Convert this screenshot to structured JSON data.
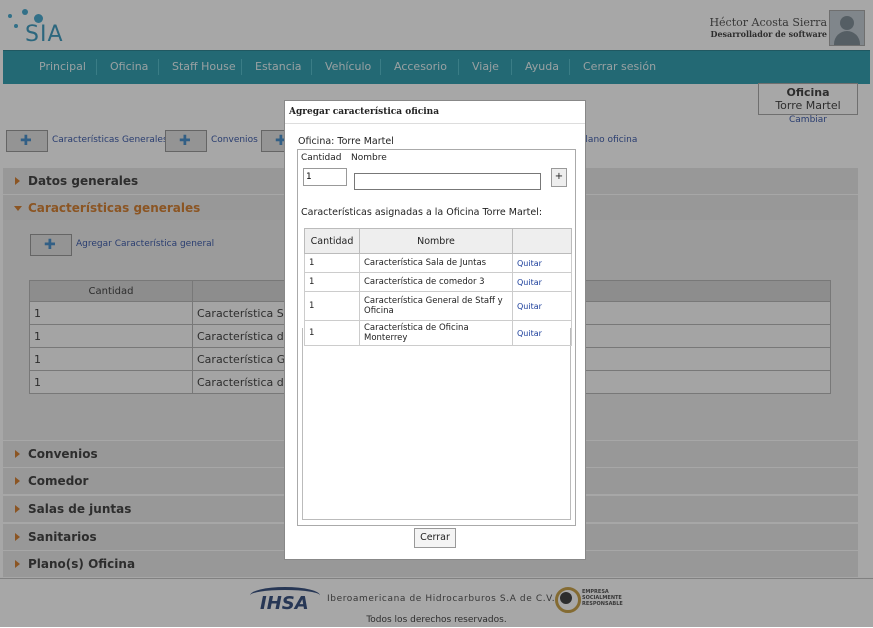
{
  "header": {
    "logo_text": "SIA",
    "user_name": "Héctor Acosta Sierra",
    "user_role": "Desarrollador de software"
  },
  "nav": [
    "Principal",
    "Oficina",
    "Staff House",
    "Estancia",
    "Vehículo",
    "Accesorio",
    "Viaje",
    "Ayuda",
    "Cerrar sesión"
  ],
  "office_box": {
    "title": "Oficina",
    "name": "Torre Martel",
    "change": "Cambiar"
  },
  "tabs": [
    "Características Generales",
    "Convenios",
    "Plano oficina"
  ],
  "sections": {
    "datos": "Datos generales",
    "caracteristicas": "Características generales",
    "convenios": "Convenios",
    "comedor": "Comedor",
    "salas": "Salas de juntas",
    "sanitarios": "Sanitarios",
    "planos": "Plano(s) Oficina"
  },
  "background_table": {
    "add_label": "Agregar Característica general",
    "header_qty": "Cantidad",
    "rows": [
      {
        "qty": "1",
        "name": "Característica Sala"
      },
      {
        "qty": "1",
        "name": "Característica de c"
      },
      {
        "qty": "1",
        "name": "Característica Gen"
      },
      {
        "qty": "1",
        "name": "Característica de O"
      }
    ]
  },
  "modal": {
    "title": "Agregar característica oficina",
    "office_label": "Oficina:",
    "office_name": "Torre Martel",
    "col_qty": "Cantidad",
    "col_name": "Nombre",
    "qty_value": "1",
    "name_value": "",
    "add_button": "+",
    "assigned_text": "Características asignadas a la Oficina Torre Martel:",
    "table_headers": [
      "Cantidad",
      "Nombre",
      ""
    ],
    "rows": [
      {
        "qty": "1",
        "name": "Característica Sala de Juntas",
        "action": "Quitar"
      },
      {
        "qty": "1",
        "name": "Característica de comedor 3",
        "action": "Quitar"
      },
      {
        "qty": "1",
        "name": "Característica General de Staff y Oficina",
        "action": "Quitar"
      },
      {
        "qty": "1",
        "name": "Característica de Oficina Monterrey",
        "action": "Quitar"
      }
    ],
    "close_button": "Cerrar"
  },
  "footer": {
    "logo": "IHSA",
    "company": "Iberoamericana de Hidrocarburos S.A de C.V.",
    "esr_label": "EMPRESA SOCIALMENTE RESPONSABLE",
    "rights": "Todos los derechos reservados."
  },
  "colors": {
    "nav": "#0f8fa3",
    "accent": "#cc6a10",
    "link": "#1b3e9b"
  }
}
